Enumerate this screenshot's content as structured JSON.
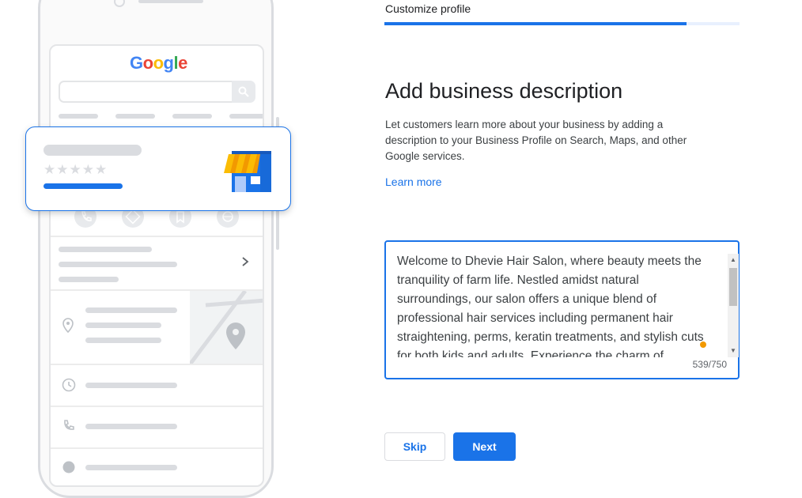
{
  "illustration": {
    "logo_letters": [
      {
        "char": "G",
        "color": "#4285F4"
      },
      {
        "char": "o",
        "color": "#EA4335"
      },
      {
        "char": "o",
        "color": "#FBBC05"
      },
      {
        "char": "g",
        "color": "#4285F4"
      },
      {
        "char": "l",
        "color": "#34A853"
      },
      {
        "char": "e",
        "color": "#EA4335"
      }
    ],
    "rating_stars": "★★★★★",
    "icons": [
      "search-icon",
      "phone-icon",
      "directions-icon",
      "bookmark-icon",
      "globe-icon",
      "chevron-right-icon",
      "location-pin-icon",
      "clock-icon",
      "storefront-icon",
      "map-icon"
    ]
  },
  "header": {
    "section_label": "Customize profile",
    "progress_percent": 85
  },
  "main": {
    "title": "Add business description",
    "description": "Let customers learn more about your business by adding a description to your Business Profile on Search, Maps, and other Google services.",
    "learn_more": "Learn more",
    "textarea_value": "Welcome to Dhevie Hair Salon, where beauty meets the tranquility of farm life. Nestled amidst natural surroundings, our salon offers a unique blend of professional hair services including permanent hair straightening, perms, keratin treatments, and stylish cuts for both kids and adults. Experience the charm of",
    "char_count": "539/750"
  },
  "buttons": {
    "skip": "Skip",
    "next": "Next"
  },
  "colors": {
    "accent": "#1a73e8",
    "skeleton": "#dadce0",
    "cursor_dot": "#f29900"
  }
}
